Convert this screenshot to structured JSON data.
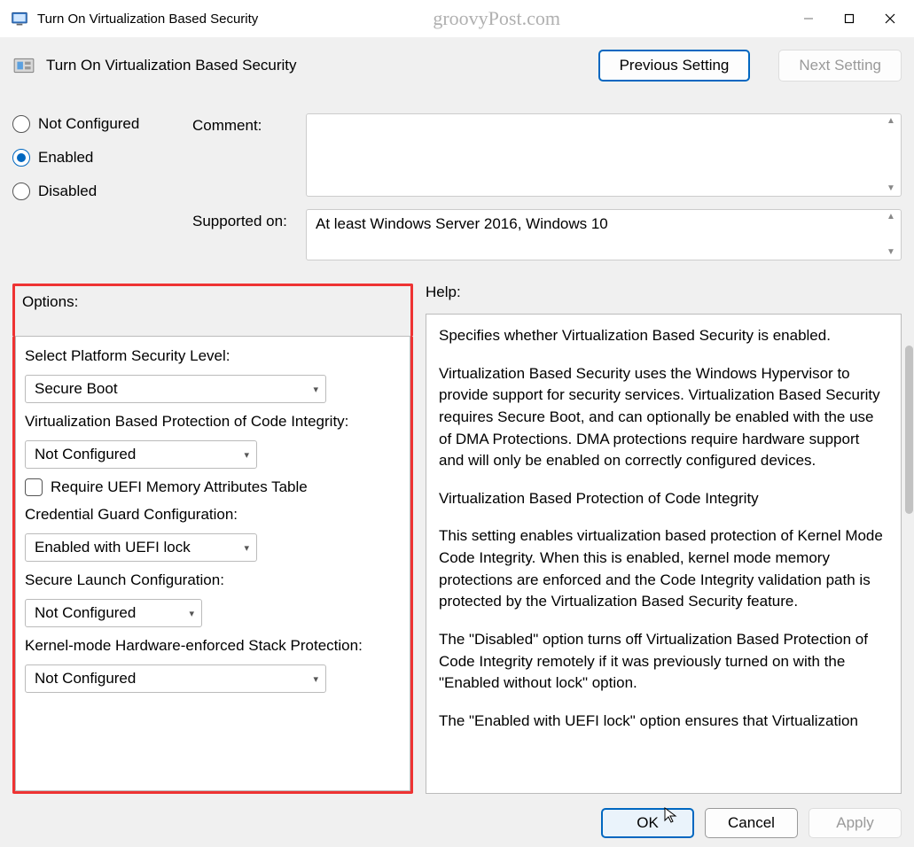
{
  "window": {
    "title": "Turn On Virtualization Based Security",
    "watermark": "groovyPost.com"
  },
  "header": {
    "policy_title": "Turn On Virtualization Based Security",
    "previous": "Previous Setting",
    "next": "Next Setting"
  },
  "state": {
    "not_configured": "Not Configured",
    "enabled": "Enabled",
    "disabled": "Disabled",
    "selected": "Enabled"
  },
  "comment": {
    "label": "Comment:",
    "value": ""
  },
  "supported": {
    "label": "Supported on:",
    "value": "At least Windows Server 2016, Windows 10"
  },
  "options": {
    "label": "Options:",
    "platform_security": {
      "label": "Select Platform Security Level:",
      "value": "Secure Boot"
    },
    "code_integrity": {
      "label": "Virtualization Based Protection of Code Integrity:",
      "value": "Not Configured"
    },
    "uefi_table": {
      "label": "Require UEFI Memory Attributes Table",
      "checked": false
    },
    "credential_guard": {
      "label": "Credential Guard Configuration:",
      "value": "Enabled with UEFI lock"
    },
    "secure_launch": {
      "label": "Secure Launch Configuration:",
      "value": "Not Configured"
    },
    "stack_protection": {
      "label": "Kernel-mode Hardware-enforced Stack Protection:",
      "value": "Not Configured"
    }
  },
  "help": {
    "label": "Help:",
    "p1": "Specifies whether Virtualization Based Security is enabled.",
    "p2": "Virtualization Based Security uses the Windows Hypervisor to provide support for security services. Virtualization Based Security requires Secure Boot, and can optionally be enabled with the use of DMA Protections. DMA protections require hardware support and will only be enabled on correctly configured devices.",
    "p3": "Virtualization Based Protection of Code Integrity",
    "p4": "This setting enables virtualization based protection of Kernel Mode Code Integrity. When this is enabled, kernel mode memory protections are enforced and the Code Integrity validation path is protected by the Virtualization Based Security feature.",
    "p5": "The \"Disabled\" option turns off Virtualization Based Protection of Code Integrity remotely if it was previously turned on with the \"Enabled without lock\" option.",
    "p6": "The \"Enabled with UEFI lock\" option ensures that Virtualization"
  },
  "footer": {
    "ok": "OK",
    "cancel": "Cancel",
    "apply": "Apply"
  }
}
